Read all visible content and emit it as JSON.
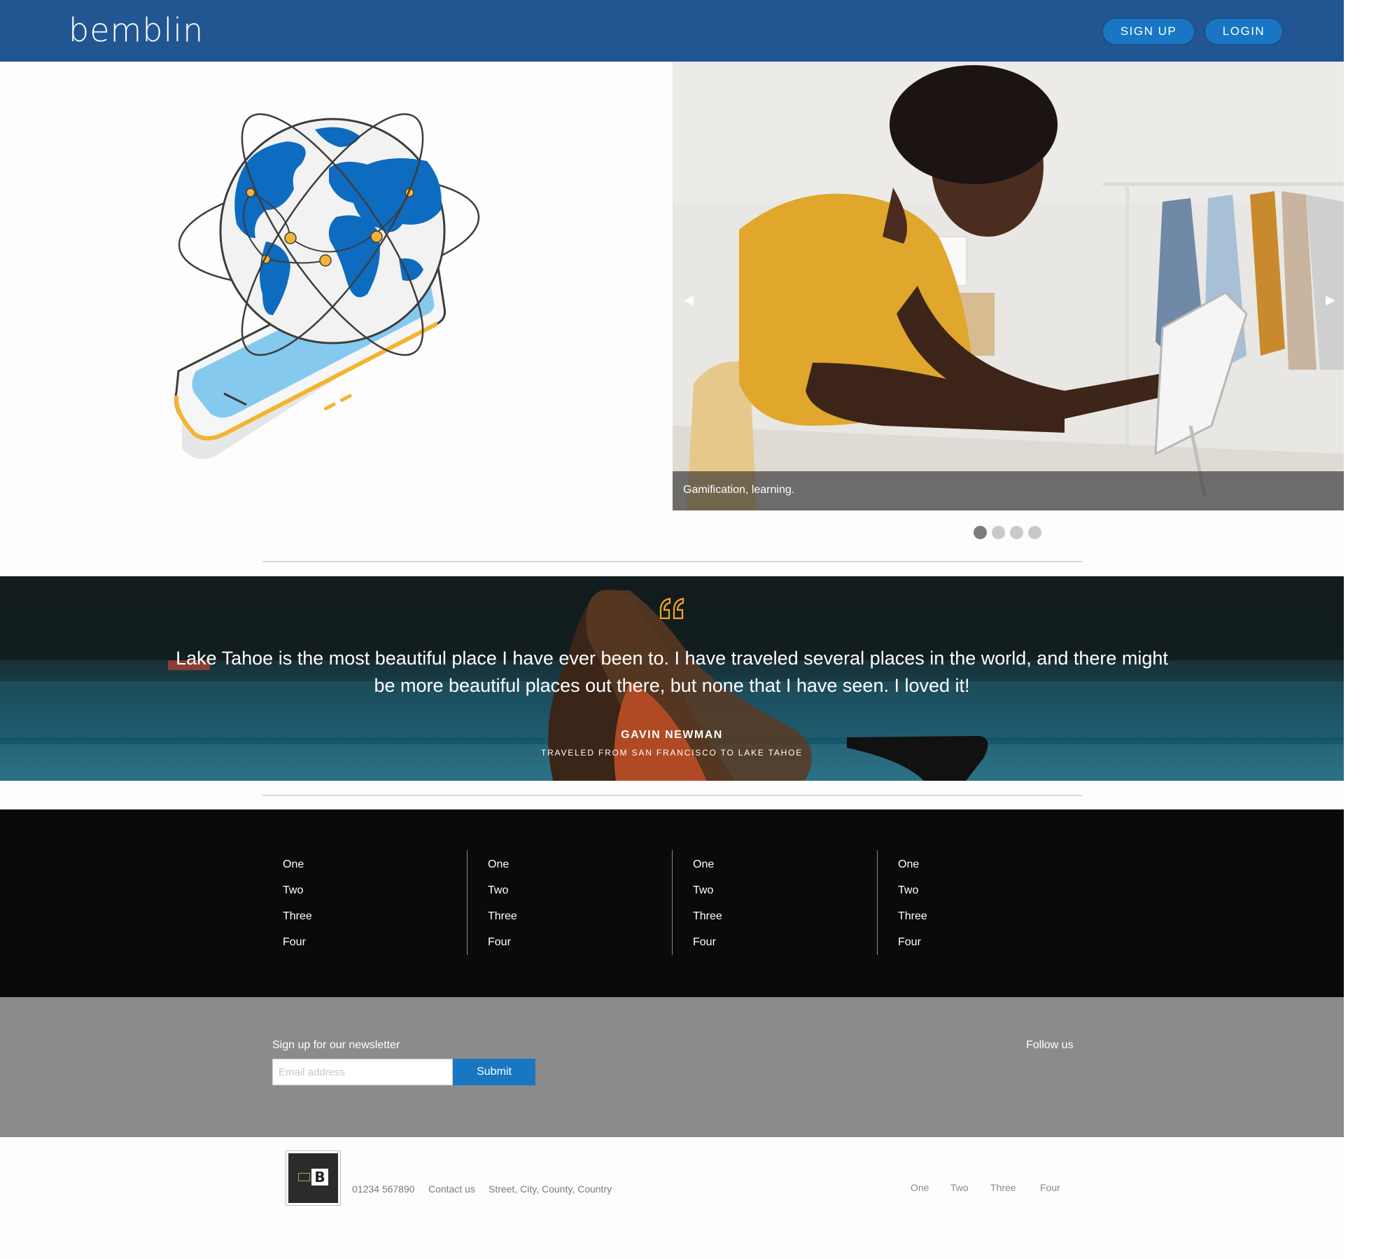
{
  "header": {
    "logo": "bemblin",
    "signup_label": "SIGN UP",
    "login_label": "LOGIN"
  },
  "hero": {
    "illustration": "globe-on-phone",
    "caption": "Gamification, learning.",
    "prev_icon": "chevron-left-icon",
    "next_icon": "chevron-right-icon",
    "slides_total": 4,
    "active_slide": 1
  },
  "testimonial": {
    "quote": "Lake Tahoe is the most beautiful place I have ever been to. I have traveled several places in the world, and there might be more beautiful places out there, but none that I have seen. I loved it!",
    "author": "GAVIN NEWMAN",
    "subtitle": "TRAVELED FROM SAN FRANCISCO TO LAKE TAHOE",
    "quote_color": "#f5a623"
  },
  "link_columns": [
    {
      "items": [
        "One",
        "Two",
        "Three",
        "Four"
      ]
    },
    {
      "items": [
        "One",
        "Two",
        "Three",
        "Four"
      ]
    },
    {
      "items": [
        "One",
        "Two",
        "Three",
        "Four"
      ]
    },
    {
      "items": [
        "One",
        "Two",
        "Three",
        "Four"
      ]
    }
  ],
  "newsletter": {
    "label": "Sign up for our newsletter",
    "placeholder": "Email address",
    "submit_label": "Submit",
    "follow_label": "Follow us"
  },
  "footer": {
    "phone": "01234 567890",
    "contact": "Contact us",
    "address": "Street, City, County, Country",
    "links": [
      "One",
      "Two",
      "Three",
      "Four"
    ]
  },
  "colors": {
    "header_bg": "#225693",
    "button_bg": "#1876c4",
    "link_band_bg": "#0a0a0a",
    "newsletter_bg": "#8b8b8b",
    "submit_bg": "#1976c1"
  }
}
